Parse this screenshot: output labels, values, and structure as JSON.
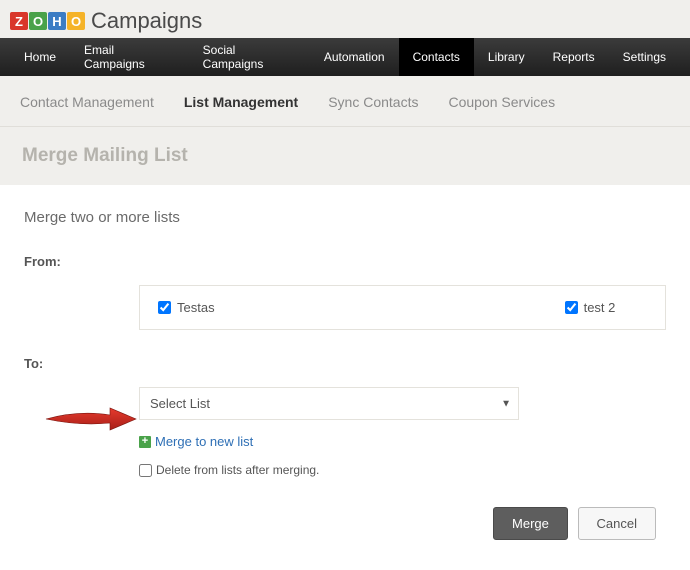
{
  "brand": "Campaigns",
  "nav": {
    "items": [
      "Home",
      "Email Campaigns",
      "Social Campaigns",
      "Automation",
      "Contacts",
      "Library",
      "Reports",
      "Settings"
    ],
    "active": "Contacts"
  },
  "subnav": {
    "items": [
      "Contact Management",
      "List Management",
      "Sync Contacts",
      "Coupon Services"
    ],
    "active": "List Management"
  },
  "page_title": "Merge Mailing List",
  "subtitle": "Merge two or more lists",
  "labels": {
    "from": "From:",
    "to": "To:"
  },
  "from_options": [
    {
      "label": "Testas",
      "checked": true
    },
    {
      "label": "test 2",
      "checked": true
    }
  ],
  "to_select": {
    "placeholder": "Select List"
  },
  "merge_new_link": "Merge to new list",
  "delete_after": {
    "label": "Delete from lists after merging.",
    "checked": false
  },
  "buttons": {
    "merge": "Merge",
    "cancel": "Cancel"
  }
}
